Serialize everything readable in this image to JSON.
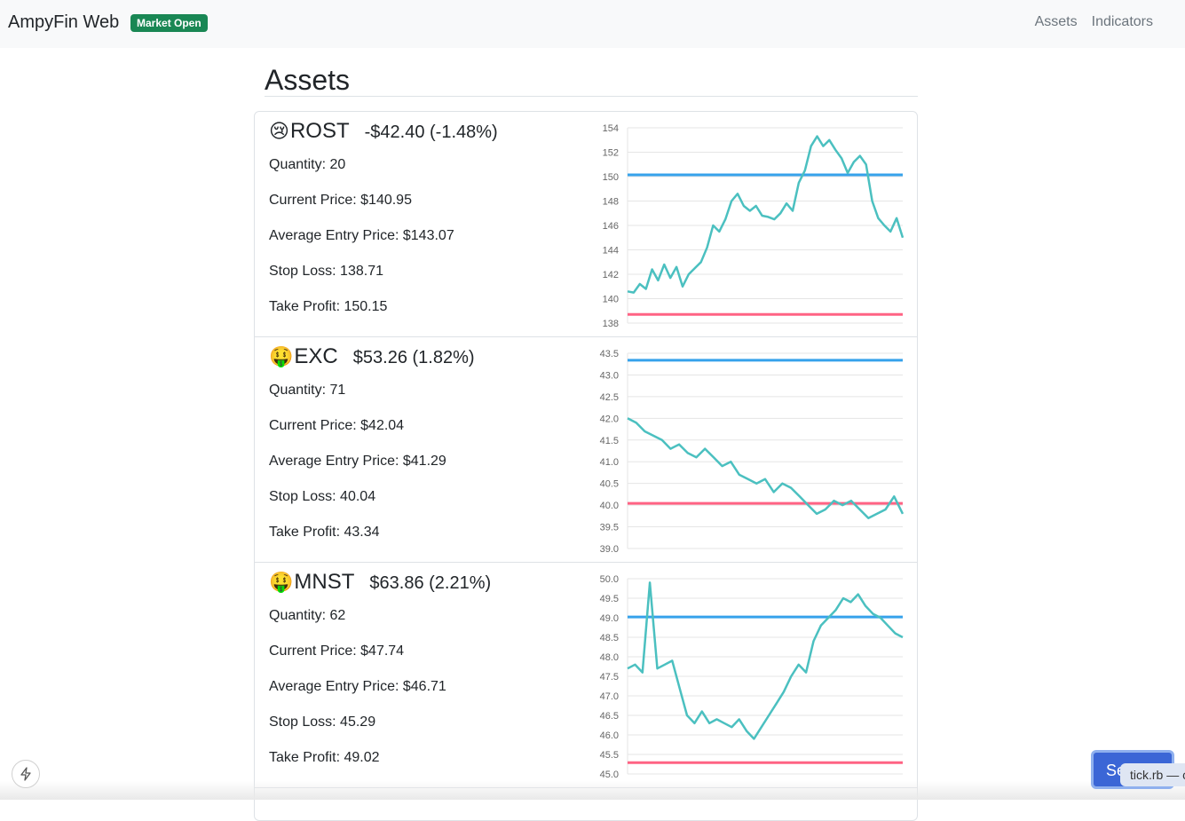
{
  "nav": {
    "brand": "AmpyFin Web",
    "status_badge": "Market Open",
    "links": [
      "Assets",
      "Indicators"
    ]
  },
  "page": {
    "title": "Assets"
  },
  "assets": [
    {
      "emoji": "😢",
      "ticker": "ROST",
      "change": "-$42.40 (-1.48%)",
      "quantity": "Quantity: 20",
      "current_price": "Current Price: $140.95",
      "avg_entry": "Average Entry Price: $143.07",
      "stop_loss": "Stop Loss: 138.71",
      "take_profit": "Take Profit: 150.15"
    },
    {
      "emoji": "🤑",
      "ticker": "EXC",
      "change": "$53.26 (1.82%)",
      "quantity": "Quantity: 71",
      "current_price": "Current Price: $42.04",
      "avg_entry": "Average Entry Price: $41.29",
      "stop_loss": "Stop Loss: 40.04",
      "take_profit": "Take Profit: 43.34"
    },
    {
      "emoji": "🤑",
      "ticker": "MNST",
      "change": "$63.86 (2.21%)",
      "quantity": "Quantity: 62",
      "current_price": "Current Price: $47.74",
      "avg_entry": "Average Entry Price: $46.71",
      "stop_loss": "Stop Loss: 45.29",
      "take_profit": "Take Profit: 49.02"
    }
  ],
  "chart_data": [
    {
      "type": "line",
      "yticks": [
        "154",
        "152",
        "150",
        "148",
        "146",
        "144",
        "142",
        "140",
        "138"
      ],
      "ylim": [
        138,
        154
      ],
      "take_profit": 150.15,
      "stop_loss": 138.71,
      "series": [
        {
          "values": [
            140.6,
            140.5,
            141.2,
            140.8,
            142.4,
            141.5,
            142.8,
            141.7,
            142.6,
            141.0,
            142.0,
            142.5,
            143.0,
            144.2,
            146.0,
            145.5,
            146.5,
            148.0,
            148.6,
            147.6,
            147.2,
            147.6,
            146.8,
            146.7,
            146.5,
            147.0,
            147.8,
            147.2,
            149.5,
            150.5,
            152.5,
            153.3,
            152.5,
            153.0,
            152.2,
            151.5,
            150.3,
            151.2,
            151.7,
            151.0,
            148.0,
            146.6,
            146.0,
            145.5,
            146.6,
            145.0
          ]
        }
      ],
      "colors": {
        "line": "#4bc0c0",
        "take_profit": "#36a2eb",
        "stop_loss": "#ff6384"
      }
    },
    {
      "type": "line",
      "yticks": [
        "43.5",
        "43.0",
        "42.5",
        "42.0",
        "41.5",
        "41.0",
        "40.5",
        "40.0",
        "39.5",
        "39.0"
      ],
      "ylim": [
        39.0,
        43.5
      ],
      "take_profit": 43.34,
      "stop_loss": 40.04,
      "series": [
        {
          "values": [
            42.0,
            41.9,
            41.7,
            41.6,
            41.5,
            41.3,
            41.4,
            41.2,
            41.1,
            41.3,
            41.1,
            40.9,
            41.0,
            40.7,
            40.6,
            40.5,
            40.6,
            40.3,
            40.5,
            40.4,
            40.2,
            40.0,
            39.8,
            39.9,
            40.1,
            40.0,
            40.1,
            39.9,
            39.7,
            39.8,
            39.9,
            40.2,
            39.8
          ]
        }
      ],
      "colors": {
        "line": "#4bc0c0",
        "take_profit": "#36a2eb",
        "stop_loss": "#ff6384"
      }
    },
    {
      "type": "line",
      "yticks": [
        "50.0",
        "49.5",
        "49.0",
        "48.5",
        "48.0",
        "47.5",
        "47.0",
        "46.5",
        "46.0",
        "45.5",
        "45.0"
      ],
      "ylim": [
        45.0,
        50.0
      ],
      "take_profit": 49.02,
      "stop_loss": 45.29,
      "series": [
        {
          "values": [
            47.7,
            47.8,
            47.6,
            49.9,
            47.7,
            47.8,
            47.9,
            47.2,
            46.5,
            46.3,
            46.6,
            46.3,
            46.4,
            46.3,
            46.2,
            46.4,
            46.1,
            45.9,
            46.2,
            46.5,
            46.8,
            47.1,
            47.5,
            47.8,
            47.6,
            48.4,
            48.8,
            49.0,
            49.2,
            49.5,
            49.4,
            49.6,
            49.3,
            49.1,
            49.0,
            48.8,
            48.6,
            48.5
          ]
        }
      ],
      "colors": {
        "line": "#4bc0c0",
        "take_profit": "#36a2eb",
        "stop_loss": "#ff6384"
      }
    }
  ],
  "overlay": {
    "chat_button_label": "Se",
    "tooltip": "tick.rb — c",
    "bolt_icon": "lightning-icon"
  }
}
